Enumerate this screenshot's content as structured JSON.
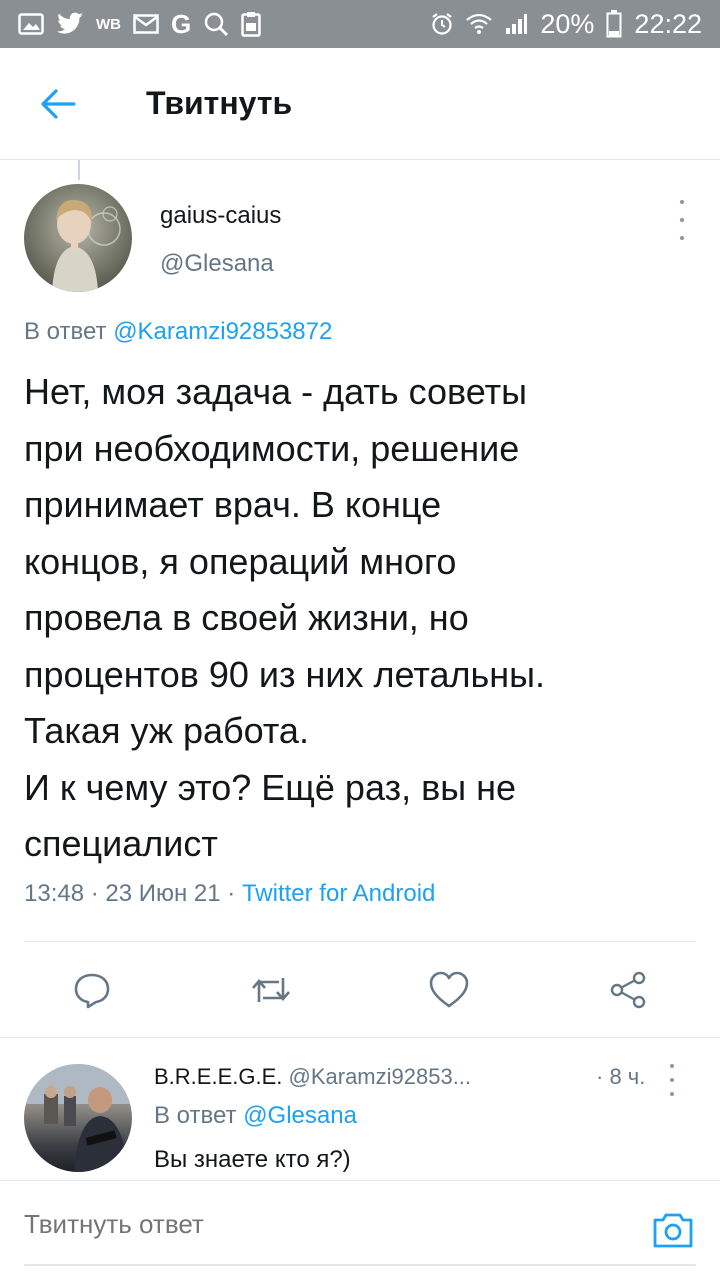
{
  "status_bar": {
    "icons_left": [
      "gallery-icon",
      "twitter-bird-icon",
      "wb-icon",
      "mail-icon",
      "google-icon",
      "search-icon",
      "clipboard-icon"
    ],
    "wb_text": "WB",
    "google_text": "G",
    "icons_right": [
      "alarm-icon",
      "wifi-icon",
      "signal-icon",
      "battery-icon"
    ],
    "battery": "20%",
    "time": "22:22"
  },
  "app_bar": {
    "back_icon": "arrow-left-icon",
    "title": "Твитнуть"
  },
  "tweet": {
    "author_name": "gaius-caius",
    "author_handle": "@Glesana",
    "reply_prefix": "В ответ ",
    "reply_handle": "@Karamzi92853872",
    "text_lines": [
      "Нет, моя задача - дать советы",
      "при необходимости, решение",
      "принимает врач. В конце",
      "концов, я операций много",
      "провела в своей жизни, но",
      "процентов 90 из них летальны.",
      "Такая уж работа.",
      "И к чему это? Ещё раз, вы не",
      "специалист"
    ],
    "time": "13:48",
    "separator": " · ",
    "date": "23 Июн 21",
    "source": "Twitter for Android"
  },
  "actions": {
    "reply_icon": "reply-icon",
    "retweet_icon": "retweet-icon",
    "like_icon": "heart-icon",
    "share_icon": "share-icon"
  },
  "reply": {
    "author_name": "B.R.E.E.G.E.",
    "author_handle": "@Karamzi92853...",
    "time": "· 8 ч.",
    "reply_prefix": "В ответ ",
    "reply_handle": "@Glesana",
    "text": "Вы знаете кто я?)"
  },
  "composer": {
    "placeholder": "Твитнуть ответ",
    "camera_icon": "camera-icon"
  },
  "colors": {
    "accent": "#1da1f2",
    "secondary_text": "#657786",
    "primary_text": "#14171a",
    "status_bar": "#8a8f94"
  }
}
